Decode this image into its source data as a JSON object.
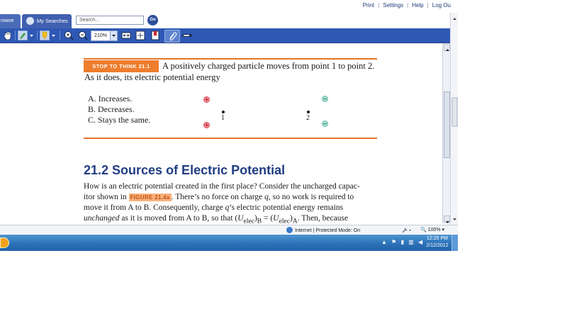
{
  "toplinks": {
    "print": "Print",
    "settings": "Settings",
    "help": "Help",
    "logout": "Log Ou"
  },
  "tabs": {
    "browse": "rowse",
    "my_searches": "My Searches"
  },
  "search": {
    "placeholder": "Search...",
    "go": "Go"
  },
  "toolbar": {
    "zoom": "210%"
  },
  "stop_to_think": {
    "badge": "STOP TO THINK 21.1",
    "question_line1": "A positively charged particle moves from point 1 to point 2.",
    "question_line2": "As it does, its electric potential energy",
    "options": [
      "A. Increases.",
      "B. Decreases.",
      "C. Stays the same."
    ],
    "point1": "1",
    "point2": "2",
    "plus": "+",
    "minus": "−"
  },
  "section": {
    "title": "21.2  Sources of Electric Potential",
    "line1": "How is an electric potential created in the first place? Consider the uncharged capac-",
    "line2_a": "itor shown in",
    "figure_ref": "FIGURE 21.4a",
    "line2_b": ". There’s no force on charge",
    "line2_q": "q",
    "line2_c": ", so no work is required to",
    "line3": "move it from A to B. Consequently, charge",
    "line3_q": "q",
    "line3_b": "’s electric potential energy remains",
    "line4_a": "unchanged",
    "line4_b": "as it is moved from A to B, so that (",
    "line4_u1": "U",
    "line4_sub1": "elec",
    "line4_c": ")",
    "line4_subB": "B",
    "line4_d": " = (",
    "line4_u2": "U",
    "line4_sub2": "elec",
    "line4_e": ")",
    "line4_subA": "A",
    "line4_f": ". Then, because"
  },
  "statusbar": {
    "zone": "Internet | Protected Mode: On",
    "zoom": "100%"
  },
  "taskbar": {
    "time": "12:25 PM",
    "date": "2/12/2012"
  }
}
